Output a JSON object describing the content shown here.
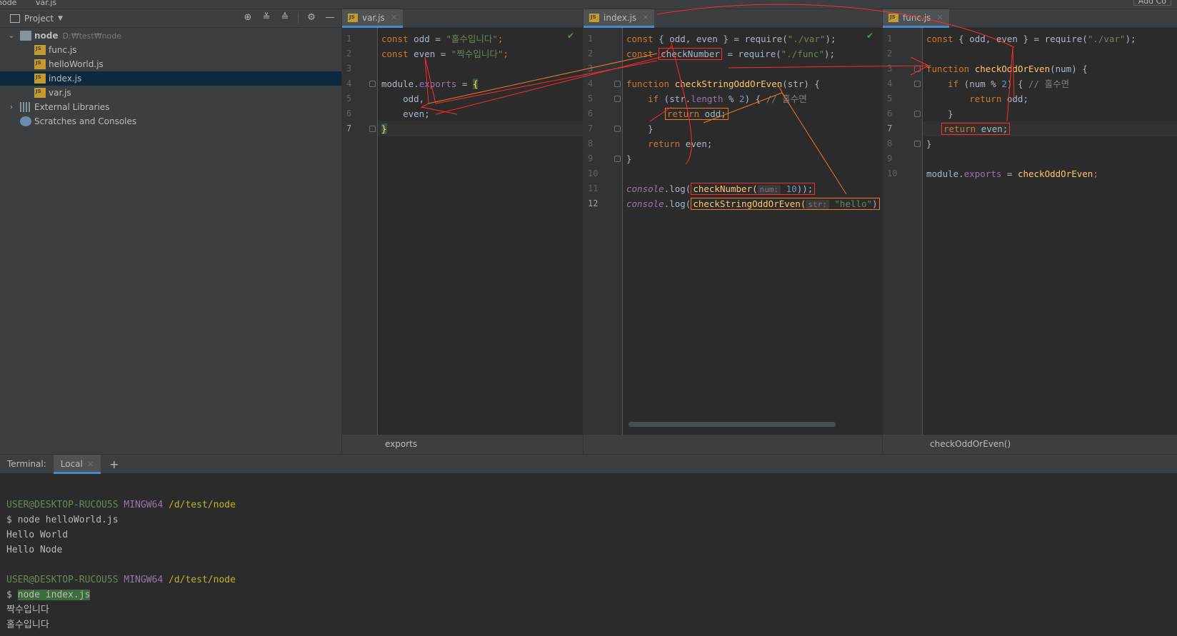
{
  "topbar": {
    "root_crumb": "node",
    "file_crumb": "var.js",
    "add_button": "Add Co"
  },
  "project": {
    "title": "Project",
    "tools": [
      "locate-icon",
      "expand-all-icon",
      "collapse-all-icon",
      "gear-icon",
      "minimize-icon"
    ],
    "root_name": "node",
    "root_path": "D:₩test₩node",
    "files": [
      {
        "name": "func.js"
      },
      {
        "name": "helloWorld.js"
      },
      {
        "name": "index.js"
      },
      {
        "name": "var.js"
      }
    ],
    "external_libraries": "External Libraries",
    "scratches": "Scratches and Consoles"
  },
  "editors": {
    "var": {
      "tab": "var.js",
      "status": "exports",
      "lines": [
        "1",
        "2",
        "3",
        "4",
        "5",
        "6",
        "7"
      ],
      "code": {
        "l1_kw": "const",
        "l1_id": " odd = ",
        "l1_str": "\"홀수입니다\"",
        "l1_end": ";",
        "l2_kw": "const",
        "l2_id": " even = ",
        "l2_str": "\"짝수입니다\"",
        "l2_end": ";",
        "l4_a": "module.",
        "l4_b": "exports",
        "l4_c": " = ",
        "l4_d": "{",
        "l5": "    odd,",
        "l6": "    even;",
        "l7": "}"
      }
    },
    "index": {
      "tab": "index.js",
      "lines": [
        "1",
        "2",
        "3",
        "4",
        "5",
        "6",
        "7",
        "8",
        "9",
        "10",
        "11",
        "12"
      ],
      "code": {
        "l1_kw": "const",
        "l1_a": " { odd, even } = require(",
        "l1_str": "\"./var\"",
        "l1_end": ");",
        "l2_kw": "const",
        "l2_box": "checkNumber",
        "l2_a": " = require(",
        "l2_str": "\"./func\"",
        "l2_end": ");",
        "l4_kw": "function",
        "l4_fn": " checkStringOddOrEven",
        "l4_a": "(str) {",
        "l5_kw": "    if",
        "l5_a": " (str.",
        "l5_prop": "length",
        "l5_b": " % ",
        "l5_num": "2",
        "l5_c": ") { ",
        "l5_cmt": "// 홀수면",
        "l6_kw": "return",
        "l6_a": " odd;",
        "l7": "    }",
        "l8_kw": "    return",
        "l8_a": " even;",
        "l9": "}",
        "l11_cons": "console",
        "l11_a": ".log(",
        "l11_b": "checkNumber(",
        "l11_hint": "num:",
        "l11_num": " 10",
        "l11_c": "));",
        "l12_cons": "console",
        "l12_a": ".log(",
        "l12_b": "checkStringOddOrEven(",
        "l12_hint": "str:",
        "l12_str": " \"hello\"",
        "l12_c": ")"
      }
    },
    "func": {
      "tab": "func.js",
      "status": "checkOddOrEven()",
      "lines": [
        "1",
        "2",
        "3",
        "4",
        "5",
        "6",
        "7",
        "8",
        "9",
        "10"
      ],
      "code": {
        "l1_kw": "const",
        "l1_a": " { odd, even } = require(",
        "l1_str": "\"./var\"",
        "l1_end": ");",
        "l3_kw": "function",
        "l3_fn": " checkOddOrEven",
        "l3_a": "(num) {",
        "l4_kw": "    if",
        "l4_a": " (num % ",
        "l4_num": "2",
        "l4_b": ") { ",
        "l4_cmt": "// 홀수면",
        "l5_kw": "        return",
        "l5_a": " odd;",
        "l6": "    }",
        "l7_kw": "return",
        "l7_a": " even;",
        "l8": "}",
        "l10_a": "module.",
        "l10_prop": "exports",
        "l10_b": " = ",
        "l10_fn": "checkOddOrEven",
        "l10_c": ";"
      }
    }
  },
  "terminal": {
    "label": "Terminal:",
    "tab": "Local",
    "user": "USER@DESKTOP-RUCOU5S",
    "env": "MINGW64",
    "path": "/d/test/node",
    "prompt": "$",
    "cmd1": "node helloWorld.js",
    "out1": "Hello World",
    "out2": "Hello Node",
    "cmd2": "node index.js",
    "out3": "짝수입니다",
    "out4": "홀수입니다"
  },
  "colors": {
    "annotation_red": "#ff2b2b",
    "annotation_orange": "#f07a2a",
    "selection": "#0d293e",
    "keyword": "#cc7832",
    "string": "#6a8759"
  }
}
